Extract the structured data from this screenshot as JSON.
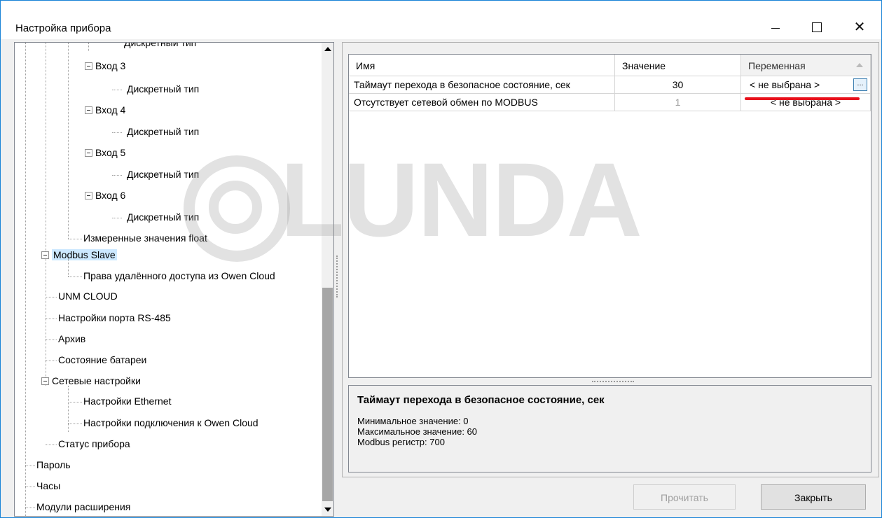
{
  "window": {
    "title": "Настройка прибора"
  },
  "tree": {
    "items": [
      {
        "label": "Дискретный тип"
      },
      {
        "label": "Вход 3"
      },
      {
        "label": "Дискретный тип"
      },
      {
        "label": "Вход 4"
      },
      {
        "label": "Дискретный тип"
      },
      {
        "label": "Вход 5"
      },
      {
        "label": "Дискретный тип"
      },
      {
        "label": "Вход 6"
      },
      {
        "label": "Дискретный тип"
      },
      {
        "label": "Измеренные значения float"
      },
      {
        "label": "Modbus Slave"
      },
      {
        "label": "Права удалённого доступа из Owen Cloud"
      },
      {
        "label": "UNM CLOUD"
      },
      {
        "label": "Настройки порта RS-485"
      },
      {
        "label": "Архив"
      },
      {
        "label": "Состояние батареи"
      },
      {
        "label": "Сетевые настройки"
      },
      {
        "label": "Настройки Ethernet"
      },
      {
        "label": "Настройки подключения к Owen Cloud"
      },
      {
        "label": "Статус прибора"
      },
      {
        "label": "Пароль"
      },
      {
        "label": "Часы"
      },
      {
        "label": "Модули расширения"
      }
    ]
  },
  "grid": {
    "headers": {
      "name": "Имя",
      "value": "Значение",
      "variable": "Переменная"
    },
    "rows": [
      {
        "name": "Таймаут перехода в безопасное состояние, сек",
        "value": "30",
        "variable": "< не выбрана >",
        "button": "..."
      },
      {
        "name": "Отсутствует сетевой обмен по MODBUS",
        "value": "1",
        "variable": "< не выбрана >"
      }
    ]
  },
  "description": {
    "title": "Таймаут перехода в безопасное состояние, сек",
    "lines": [
      "Минимальное значение: 0",
      "Максимальное значение: 60",
      "Modbus регистр: 700"
    ]
  },
  "buttons": {
    "read": "Прочитать",
    "close": "Закрыть"
  },
  "watermark": {
    "text": "LUNDA"
  },
  "colors": {
    "accent": "#1883d7",
    "highlight": "#e8101b",
    "selection": "#cce8ff"
  }
}
